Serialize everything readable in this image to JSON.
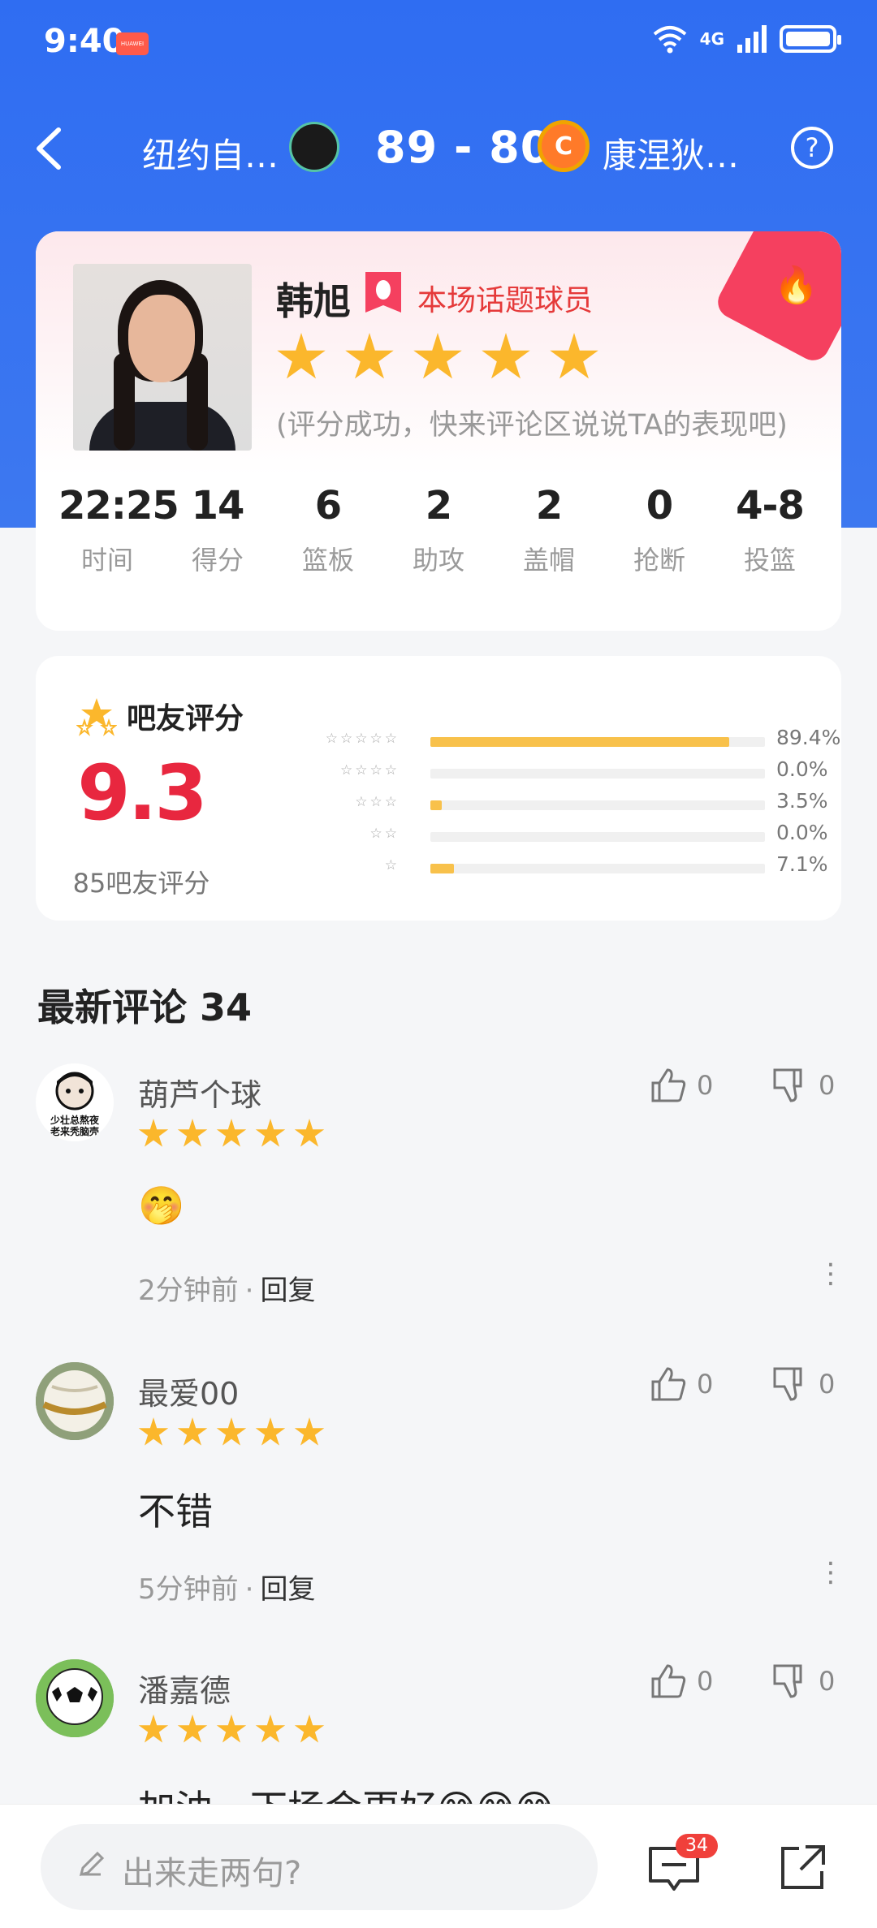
{
  "status": {
    "time": "9:40",
    "app_tag": "HUAWEI",
    "network": "4G"
  },
  "header": {
    "team_home": "纽约自…",
    "score": "89 - 80",
    "team_away": "康涅狄…",
    "help_label": "?",
    "away_logo_letter": "C"
  },
  "player": {
    "name": "韩旭",
    "hot_label": "本场话题球员",
    "hint": "(评分成功，快来评论区说说TA的表现吧)",
    "stats": [
      {
        "value": "22:25",
        "label": "时间"
      },
      {
        "value": "14",
        "label": "得分"
      },
      {
        "value": "6",
        "label": "篮板"
      },
      {
        "value": "2",
        "label": "助攻"
      },
      {
        "value": "2",
        "label": "盖帽"
      },
      {
        "value": "0",
        "label": "抢断"
      },
      {
        "value": "4-8",
        "label": "投篮"
      }
    ]
  },
  "rating": {
    "title": "吧友评分",
    "score": "9.3",
    "count": "85吧友评分",
    "rows": [
      {
        "stars": "☆☆☆☆☆",
        "fraction": 0.894,
        "pct": "89.4%"
      },
      {
        "stars": "☆☆☆☆",
        "fraction": 0.0,
        "pct": "0.0%"
      },
      {
        "stars": "☆☆☆",
        "fraction": 0.035,
        "pct": "3.5%"
      },
      {
        "stars": "☆☆",
        "fraction": 0.0,
        "pct": "0.0%"
      },
      {
        "stars": "☆",
        "fraction": 0.071,
        "pct": "7.1%"
      }
    ]
  },
  "comments_header": "最新评论 34",
  "comments": [
    {
      "user": "葫芦个球",
      "stars": 5,
      "text": "🤭",
      "time": "2分钟前",
      "reply": "回复",
      "likes": "0",
      "dislikes": "0",
      "avatar_text": "少壮总熬夜 老来秃脑壳"
    },
    {
      "user": "最爱00",
      "stars": 5,
      "text": "不错",
      "time": "5分钟前",
      "reply": "回复",
      "likes": "0",
      "dislikes": "0"
    },
    {
      "user": "潘嘉德",
      "stars": 5,
      "text": "加油，下场会更好😅😅😅",
      "time": "",
      "reply": "",
      "likes": "0",
      "dislikes": "0"
    }
  ],
  "bottom": {
    "placeholder": "出来走两句?",
    "badge": "34"
  },
  "colors": {
    "hero_blue": "#2f6df2",
    "accent_red": "#e8273f",
    "star_gold": "#fbb72c",
    "bar_fill": "#f8c14b"
  }
}
